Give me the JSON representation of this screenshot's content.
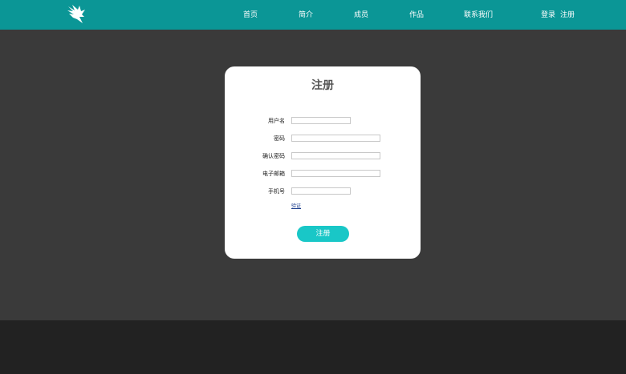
{
  "header": {
    "logo_icon": "bird-wing-logo-icon",
    "background_color": "#0b9696",
    "nav": [
      {
        "label": "首页"
      },
      {
        "label": "简介"
      },
      {
        "label": "成员"
      },
      {
        "label": "作品"
      },
      {
        "label": "联系我们"
      }
    ],
    "auth": {
      "login": "登录",
      "register": "注册"
    }
  },
  "register_form": {
    "title": "注册",
    "fields": [
      {
        "label": "用户名",
        "value": "",
        "placeholder": ""
      },
      {
        "label": "密码",
        "value": "",
        "placeholder": ""
      },
      {
        "label": "确认密码",
        "value": "",
        "placeholder": ""
      },
      {
        "label": "电子邮箱",
        "value": "",
        "placeholder": ""
      },
      {
        "label": "手机号",
        "value": "",
        "placeholder": ""
      }
    ],
    "verify_link": "验证",
    "submit_label": "注册",
    "button_color": "#19c7c7"
  },
  "colors": {
    "content_bg": "#3a3a3a",
    "footer_bg": "#222222"
  }
}
